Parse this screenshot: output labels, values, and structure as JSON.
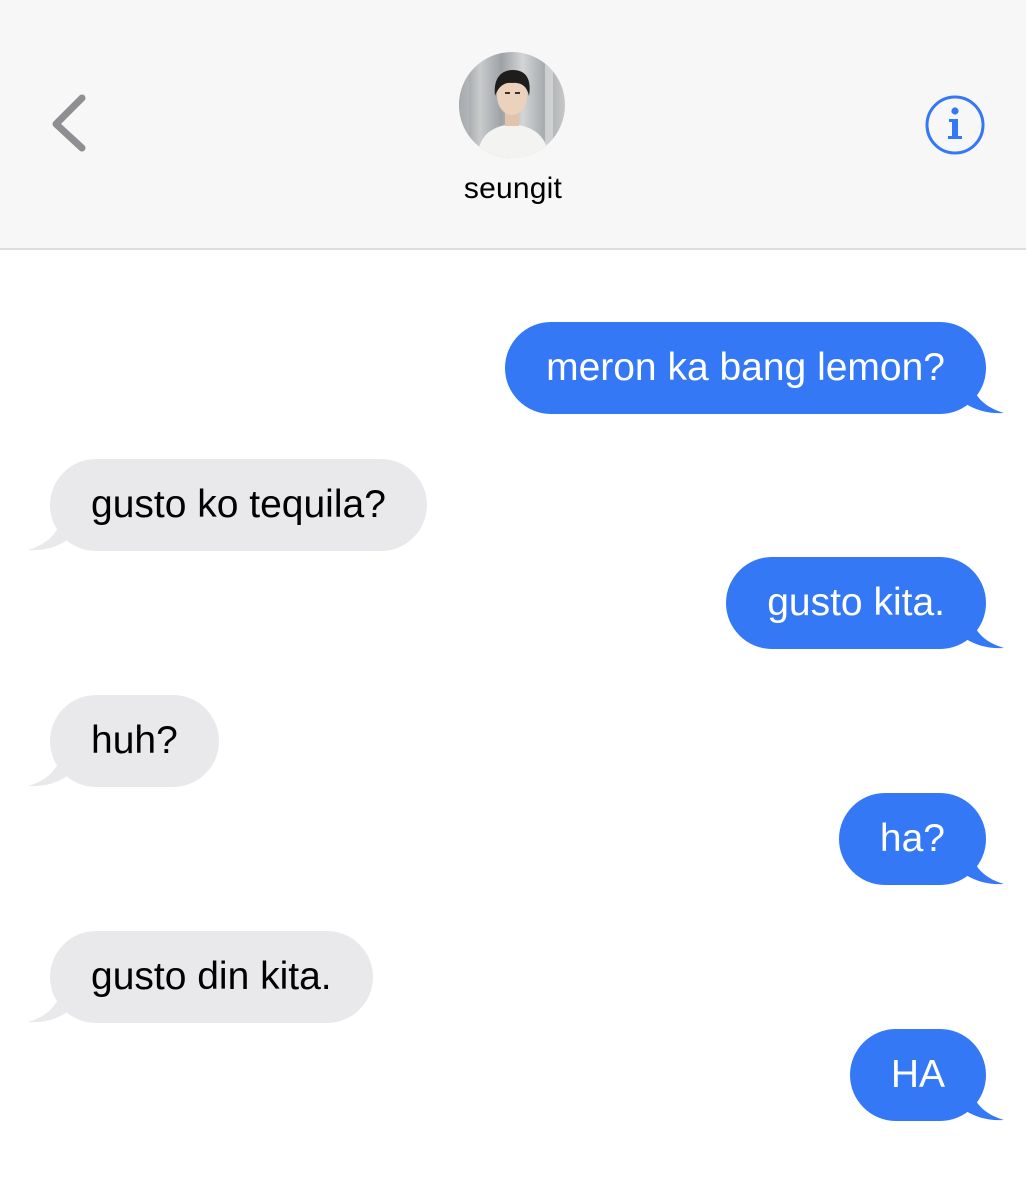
{
  "header": {
    "back_icon": "chevron-left-icon",
    "contact_name": "seungit",
    "info_icon": "info-circle-icon",
    "accent_color": "#3478f6"
  },
  "messages": [
    {
      "direction": "sent",
      "text": "meron ka bang lemon?"
    },
    {
      "direction": "received",
      "text": "gusto ko tequila?"
    },
    {
      "direction": "sent",
      "text": "gusto kita."
    },
    {
      "direction": "received",
      "text": "huh?"
    },
    {
      "direction": "sent",
      "text": "ha?"
    },
    {
      "direction": "received",
      "text": "gusto din kita."
    },
    {
      "direction": "sent",
      "text": "HA"
    }
  ],
  "colors": {
    "sent_bubble": "#3478f6",
    "received_bubble": "#e9e9eb",
    "header_background": "#f7f7f7"
  }
}
